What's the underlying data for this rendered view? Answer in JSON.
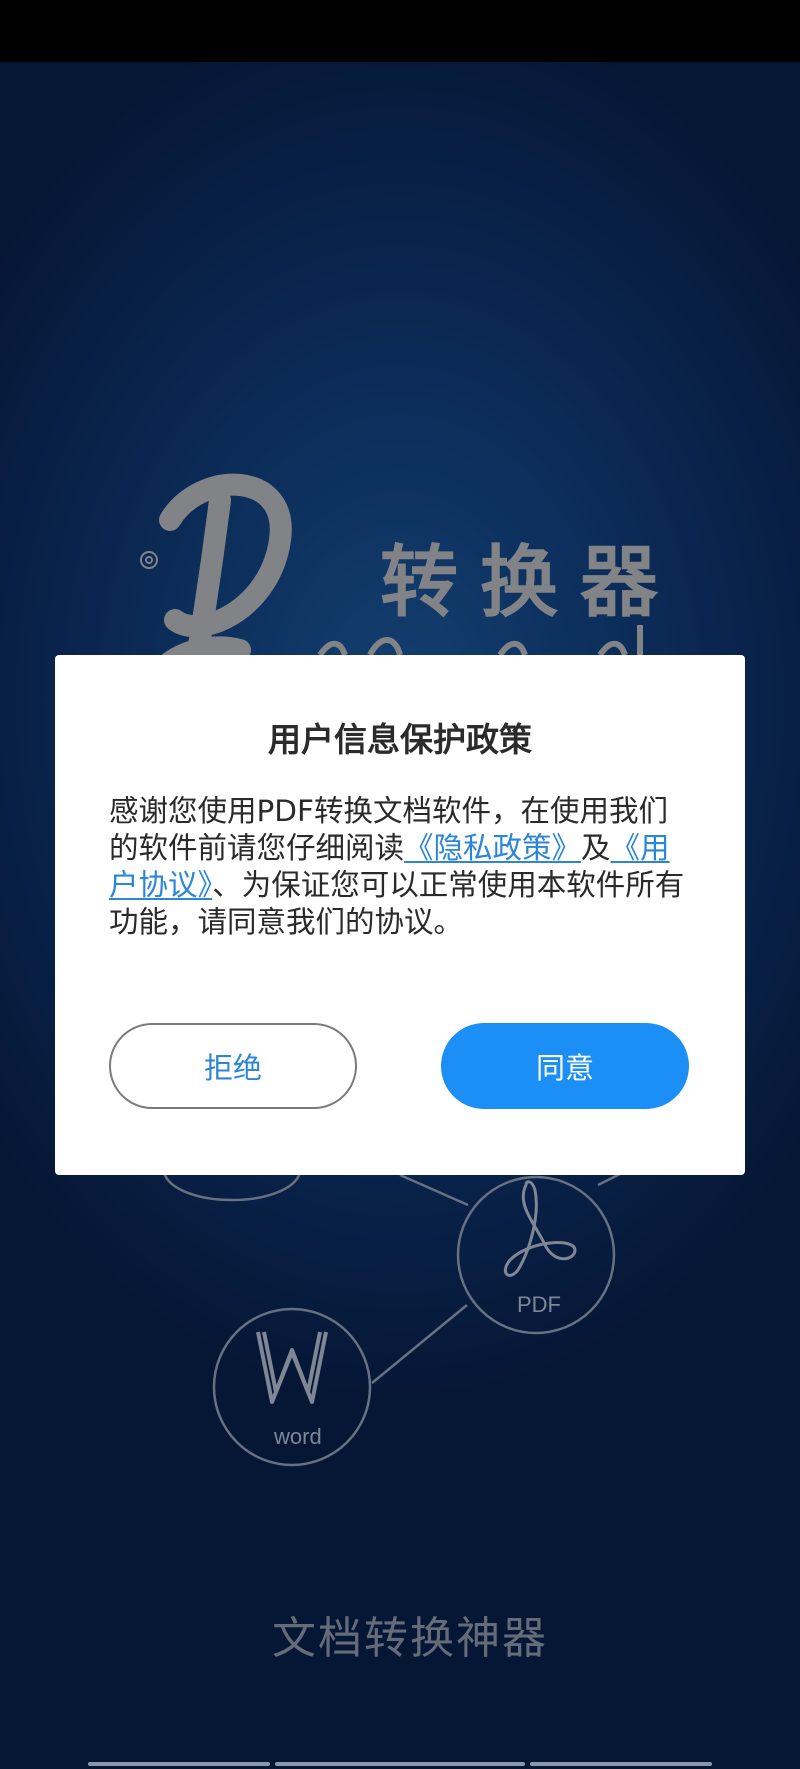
{
  "splash": {
    "logo_cn": "转换器",
    "logo_script": "Pdf to word",
    "pdf_label": "PDF",
    "word_label": "word",
    "slogan": "文档转换神器"
  },
  "dialog": {
    "title": "用户信息保护政策",
    "body_part1": "感谢您使用PDF转换文档软件，在使用我们的软件前请您仔细阅读",
    "privacy_link": "《隐私政策》",
    "body_part2": "及",
    "agreement_link": "《用户协议》",
    "body_part3": "、为保证您可以正常使用本软件所有功能，请同意我们的协议。",
    "reject_label": "拒绝",
    "agree_label": "同意"
  },
  "colors": {
    "accent": "#1b8ff5",
    "link": "#2b85d8",
    "background": "#0e3364"
  }
}
